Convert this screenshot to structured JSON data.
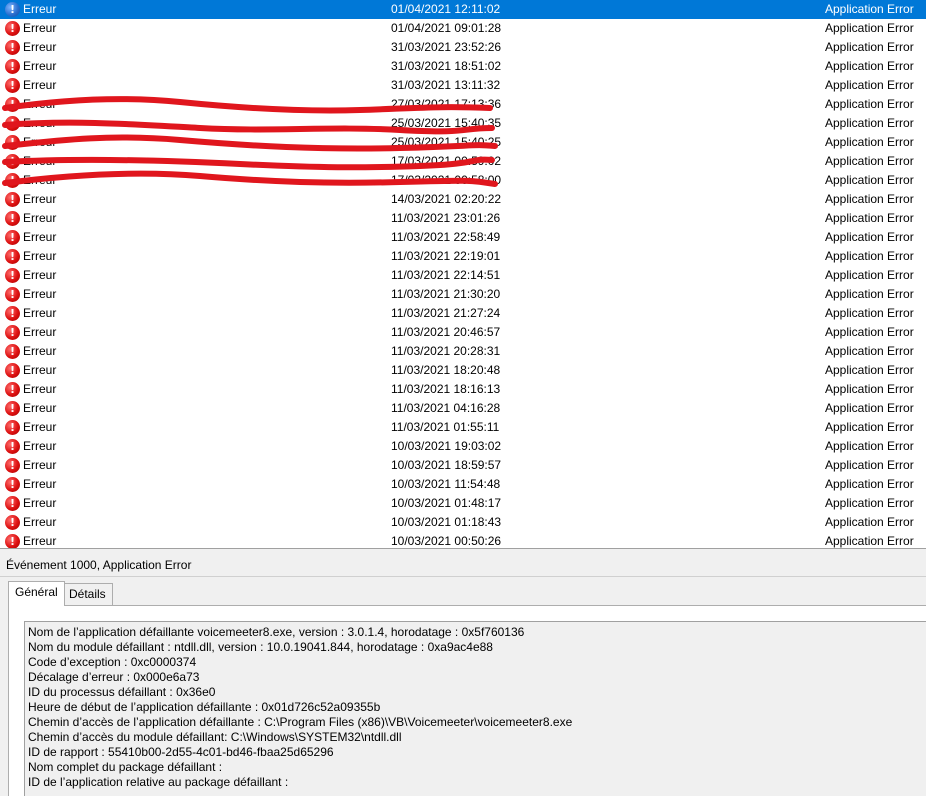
{
  "event_list": {
    "rows": [
      {
        "level": "Erreur",
        "date": "01/04/2021 12:11:02",
        "source": "Application Error",
        "selected": true
      },
      {
        "level": "Erreur",
        "date": "01/04/2021 09:01:28",
        "source": "Application Error"
      },
      {
        "level": "Erreur",
        "date": "31/03/2021 23:52:26",
        "source": "Application Error"
      },
      {
        "level": "Erreur",
        "date": "31/03/2021 18:51:02",
        "source": "Application Error"
      },
      {
        "level": "Erreur",
        "date": "31/03/2021 13:11:32",
        "source": "Application Error"
      },
      {
        "level": "Erreur",
        "date": "27/03/2021 17:13:36",
        "source": "Application Error"
      },
      {
        "level": "Erreur",
        "date": "25/03/2021 15:40:35",
        "source": "Application Error"
      },
      {
        "level": "Erreur",
        "date": "25/03/2021 15:40:25",
        "source": "Application Error"
      },
      {
        "level": "Erreur",
        "date": "17/03/2021 00:59:02",
        "source": "Application Error"
      },
      {
        "level": "Erreur",
        "date": "17/03/2021 00:58:00",
        "source": "Application Error"
      },
      {
        "level": "Erreur",
        "date": "14/03/2021 02:20:22",
        "source": "Application Error"
      },
      {
        "level": "Erreur",
        "date": "11/03/2021 23:01:26",
        "source": "Application Error"
      },
      {
        "level": "Erreur",
        "date": "11/03/2021 22:58:49",
        "source": "Application Error"
      },
      {
        "level": "Erreur",
        "date": "11/03/2021 22:19:01",
        "source": "Application Error"
      },
      {
        "level": "Erreur",
        "date": "11/03/2021 22:14:51",
        "source": "Application Error"
      },
      {
        "level": "Erreur",
        "date": "11/03/2021 21:30:20",
        "source": "Application Error"
      },
      {
        "level": "Erreur",
        "date": "11/03/2021 21:27:24",
        "source": "Application Error"
      },
      {
        "level": "Erreur",
        "date": "11/03/2021 20:46:57",
        "source": "Application Error"
      },
      {
        "level": "Erreur",
        "date": "11/03/2021 20:28:31",
        "source": "Application Error"
      },
      {
        "level": "Erreur",
        "date": "11/03/2021 18:20:48",
        "source": "Application Error"
      },
      {
        "level": "Erreur",
        "date": "11/03/2021 18:16:13",
        "source": "Application Error"
      },
      {
        "level": "Erreur",
        "date": "11/03/2021 04:16:28",
        "source": "Application Error"
      },
      {
        "level": "Erreur",
        "date": "11/03/2021 01:55:11",
        "source": "Application Error"
      },
      {
        "level": "Erreur",
        "date": "10/03/2021 19:03:02",
        "source": "Application Error"
      },
      {
        "level": "Erreur",
        "date": "10/03/2021 18:59:57",
        "source": "Application Error"
      },
      {
        "level": "Erreur",
        "date": "10/03/2021 11:54:48",
        "source": "Application Error"
      },
      {
        "level": "Erreur",
        "date": "10/03/2021 01:48:17",
        "source": "Application Error"
      },
      {
        "level": "Erreur",
        "date": "10/03/2021 01:18:43",
        "source": "Application Error"
      },
      {
        "level": "Erreur",
        "date": "10/03/2021 00:50:26",
        "source": "Application Error"
      }
    ],
    "error_icon": "error-icon",
    "error_glyph": "!",
    "scribble_color": "#e0161d",
    "selected_color": "#0078d7"
  },
  "details": {
    "title": "Événement 1000, Application Error",
    "tabs": [
      {
        "label": "Général",
        "active": true
      },
      {
        "label": "Détails",
        "active": false
      }
    ],
    "description_lines": [
      "Nom de l’application défaillante voicemeeter8.exe, version : 3.0.1.4, horodatage : 0x5f760136",
      "Nom du module défaillant : ntdll.dll, version : 10.0.19041.844, horodatage : 0xa9ac4e88",
      "Code d’exception : 0xc0000374",
      "Décalage d’erreur : 0x000e6a73",
      "ID du processus défaillant : 0x36e0",
      "Heure de début de l’application défaillante : 0x01d726c52a09355b",
      "Chemin d’accès de l’application défaillante : C:\\Program Files (x86)\\VB\\Voicemeeter\\voicemeeter8.exe",
      "Chemin d’accès du module défaillant: C:\\Windows\\SYSTEM32\\ntdll.dll",
      "ID de rapport : 55410b00-2d55-4c01-bd46-fbaa25d65296",
      "Nom complet du package défaillant :",
      "ID de l’application relative au package défaillant :"
    ]
  }
}
